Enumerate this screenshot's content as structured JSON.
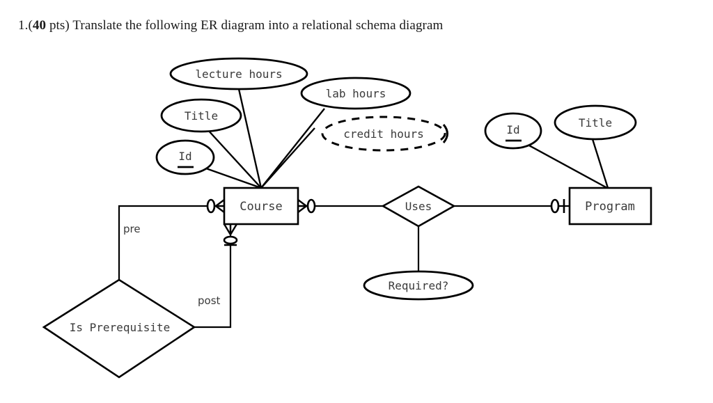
{
  "question": {
    "number": "1.",
    "points_prefix": "(",
    "points_bold": "40",
    "points_suffix": " pts)",
    "text": " Translate the following ER diagram into a relational schema diagram",
    "full_text": "1. (40 pts) Translate the following ER diagram into a relational schema diagram"
  },
  "diagram": {
    "type": "er-diagram",
    "notation": "crow's-foot",
    "entities": [
      {
        "id": "course",
        "label": "Course",
        "shape": "rectangle"
      },
      {
        "id": "program",
        "label": "Program",
        "shape": "rectangle"
      }
    ],
    "relationships": [
      {
        "id": "uses",
        "label": "Uses",
        "shape": "diamond",
        "connects": [
          "course",
          "program"
        ]
      },
      {
        "id": "is-prerequisite",
        "label": "Is Prerequisite",
        "shape": "diamond",
        "connects": [
          "course",
          "course"
        ],
        "recursive": true
      }
    ],
    "attributes": [
      {
        "id": "course-lecture-hours",
        "label": "lecture hours",
        "owner": "course",
        "style": "solid",
        "key": false
      },
      {
        "id": "course-lab-hours",
        "label": "lab hours",
        "owner": "course",
        "style": "solid",
        "key": false
      },
      {
        "id": "course-credit-hours",
        "label": "credit hours",
        "owner": "course",
        "style": "dashed",
        "key": false,
        "derived": true
      },
      {
        "id": "course-title",
        "label": "Title",
        "owner": "course",
        "style": "solid",
        "key": false
      },
      {
        "id": "course-id",
        "label": "Id",
        "owner": "course",
        "style": "solid",
        "key": true
      },
      {
        "id": "program-id",
        "label": "Id",
        "owner": "program",
        "style": "solid",
        "key": true
      },
      {
        "id": "program-title",
        "label": "Title",
        "owner": "program",
        "style": "solid",
        "key": false
      },
      {
        "id": "uses-required",
        "label": "Required?",
        "owner": "uses",
        "style": "solid",
        "key": false
      }
    ],
    "role_labels": [
      {
        "id": "role-pre",
        "label": "pre"
      },
      {
        "id": "role-post",
        "label": "post"
      }
    ],
    "colors": {
      "stroke": "#000000",
      "text": "#3a3a3a",
      "background": "#ffffff"
    }
  }
}
